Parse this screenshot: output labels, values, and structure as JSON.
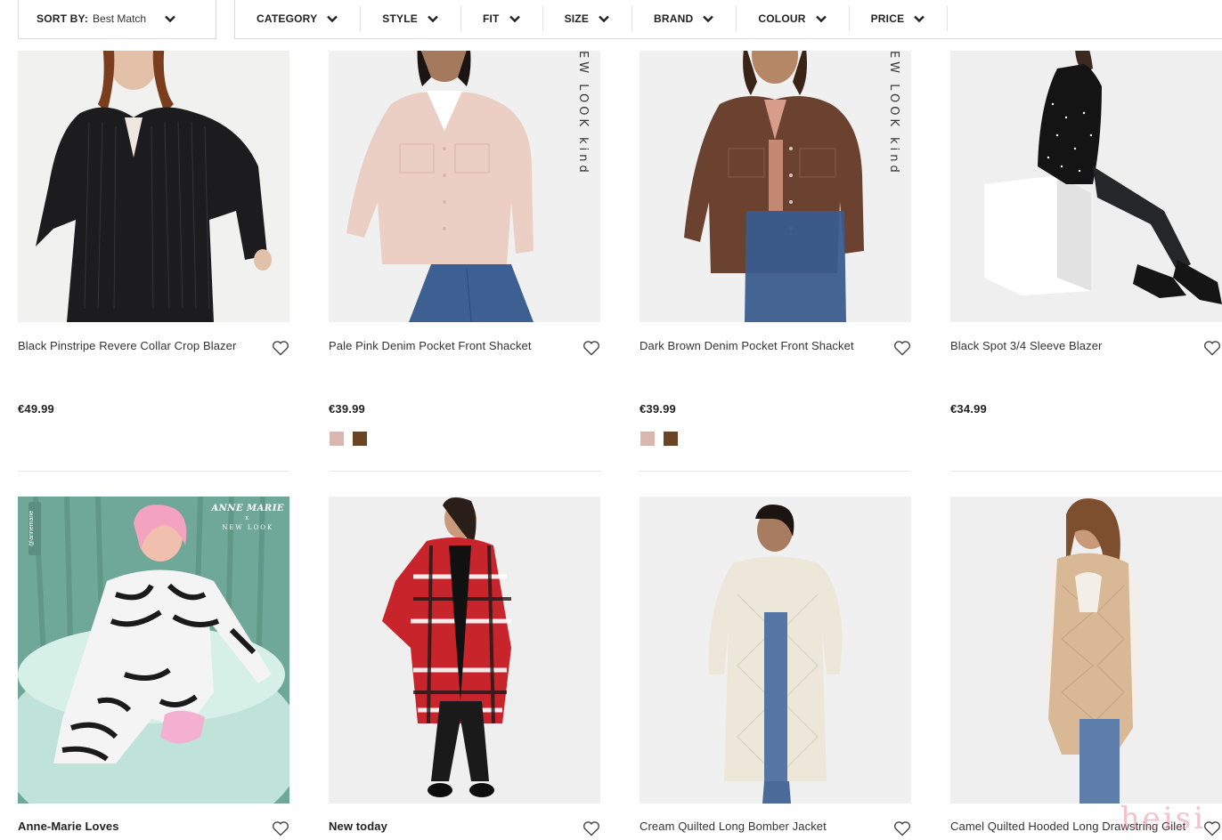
{
  "sort": {
    "label": "SORT BY:",
    "value": "Best Match"
  },
  "filters": [
    {
      "label": "CATEGORY"
    },
    {
      "label": "STYLE"
    },
    {
      "label": "FIT"
    },
    {
      "label": "SIZE"
    },
    {
      "label": "BRAND"
    },
    {
      "label": "COLOUR"
    },
    {
      "label": "PRICE"
    }
  ],
  "products": [
    {
      "title": "Black Pinstripe Revere Collar Crop Blazer",
      "price": "€49.99",
      "swatches": []
    },
    {
      "title": "Pale Pink Denim Pocket Front Shacket",
      "price": "€39.99",
      "swatches": [
        "#d9b7ae",
        "#6b4423"
      ],
      "badge": "EW LOOK kind"
    },
    {
      "title": "Dark Brown Denim Pocket Front Shacket",
      "price": "€39.99",
      "swatches": [
        "#d9b7ae",
        "#6b4423"
      ],
      "badge": "EW LOOK kind"
    },
    {
      "title": "Black Spot 3/4 Sleeve Blazer",
      "price": "€34.99",
      "swatches": []
    },
    {
      "title": "Anne-Marie Loves",
      "badge_main": "ANNE MARIE",
      "badge_x": "x",
      "badge_sub": "NEW LOOK",
      "handle": "@annemarie"
    },
    {
      "title": "New today"
    },
    {
      "title": "Cream Quilted Long Bomber Jacket"
    },
    {
      "title": "Camel Quilted Hooded Long Drawstring Gilet"
    }
  ],
  "watermark": "heisi",
  "colors": {
    "kind_accent": "#5aa02c",
    "swatch_pink": "#d9b7ae",
    "swatch_brown": "#6b4423"
  }
}
